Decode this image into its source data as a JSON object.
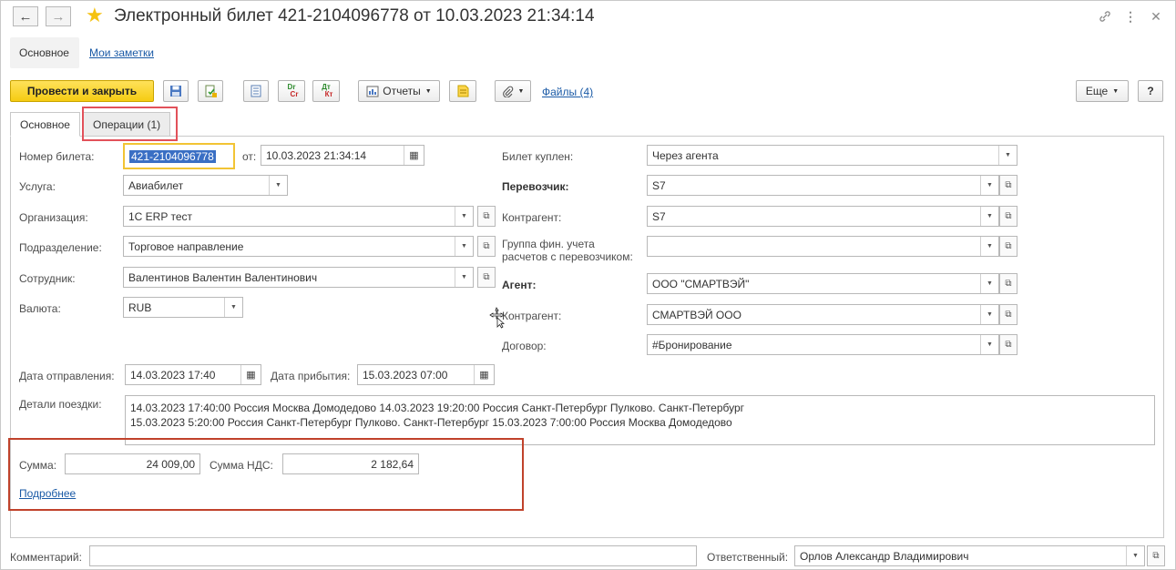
{
  "window": {
    "title": "Электронный билет 421-2104096778 от 10.03.2023 21:34:14"
  },
  "nav": {
    "back": "←",
    "forward": "→",
    "sections": [
      "Основное",
      "Мои заметки"
    ]
  },
  "toolbar": {
    "post_close": "Провести и закрыть",
    "dr": "Dr",
    "cr": "Cr",
    "dt": "Дт",
    "kt": "Кт",
    "reports": "Отчеты",
    "files": "Файлы (4)",
    "more": "Еще",
    "help": "?"
  },
  "tabs": [
    "Основное",
    "Операции (1)"
  ],
  "form": {
    "ticket_number_label": "Номер билета:",
    "ticket_number": "421-2104096778",
    "from_label": "от:",
    "from_date": "10.03.2023 21:34:14",
    "service_label": "Услуга:",
    "service": "Авиабилет",
    "org_label": "Организация:",
    "org": "1С ERP тест",
    "division_label": "Подразделение:",
    "division": "Торговое направление",
    "employee_label": "Сотрудник:",
    "employee": "Валентинов Валентин Валентинович",
    "currency_label": "Валюта:",
    "currency": "RUB",
    "bought_label": "Билет куплен:",
    "bought": "Через агента",
    "carrier_label": "Перевозчик:",
    "carrier": "S7",
    "counterparty_label": "Контрагент:",
    "counterparty": "S7",
    "fin_group_label_1": "Группа фин. учета",
    "fin_group_label_2": "расчетов с перевозчиком:",
    "fin_group": "",
    "agent_label": "Агент:",
    "agent": "ООО \"СМАРТВЭЙ\"",
    "agent_counterparty_label": "Контрагент:",
    "agent_counterparty": "СМАРТВЭЙ ООО",
    "contract_label": "Договор:",
    "contract": "#Бронирование",
    "depart_label": "Дата отправления:",
    "depart": "14.03.2023 17:40",
    "arrive_label": "Дата прибытия:",
    "arrive": "15.03.2023 07:00",
    "trip_label": "Детали поездки:",
    "trip_line_1": "14.03.2023 17:40:00 Россия Москва Домодедово 14.03.2023 19:20:00 Россия Санкт-Петербург Пулково. Санкт-Петербург",
    "trip_line_2": "15.03.2023 5:20:00 Россия Санкт-Петербург Пулково. Санкт-Петербург 15.03.2023 7:00:00 Россия Москва Домодедово",
    "sum_label": "Сумма:",
    "sum": "24 009,00",
    "vat_label": "Сумма НДС:",
    "vat": "2 182,64",
    "details_link": "Подробнее"
  },
  "footer": {
    "comment_label": "Комментарий:",
    "comment": "",
    "responsible_label": "Ответственный:",
    "responsible": "Орлов Александр Владимирович"
  }
}
